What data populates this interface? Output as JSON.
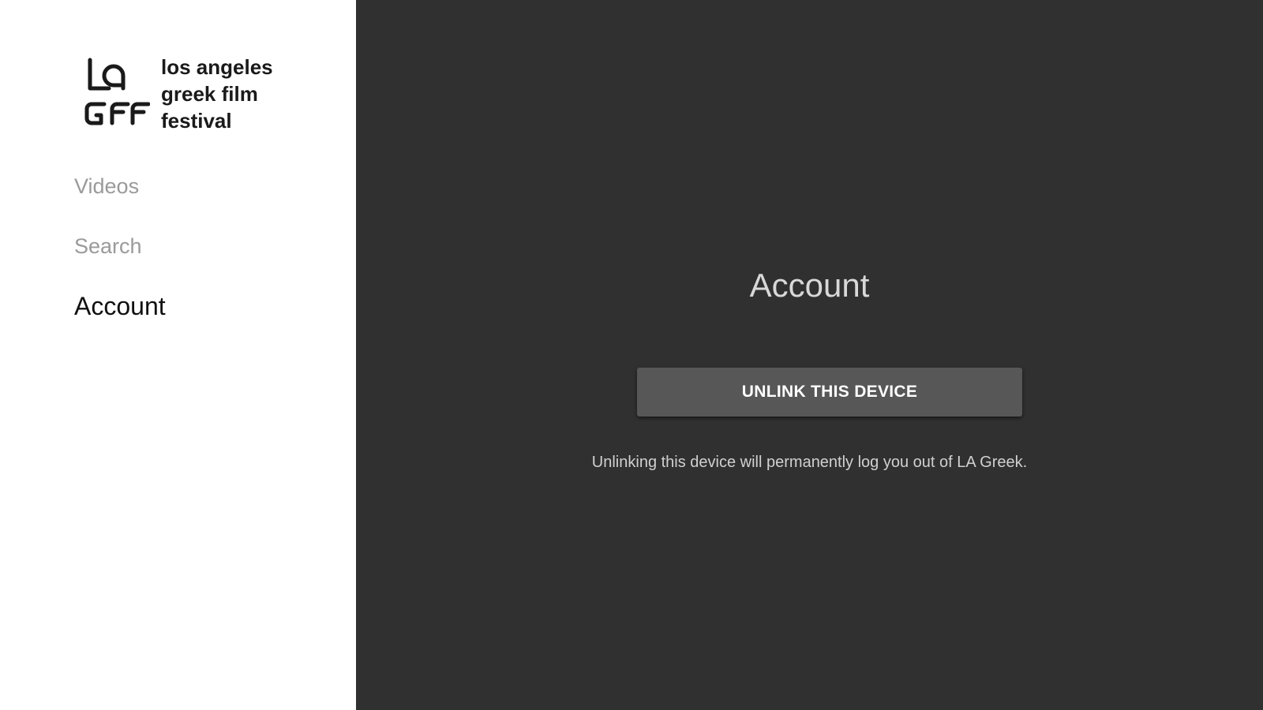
{
  "brand": {
    "logo_icon": "lagff-logo-icon",
    "line1": "los angeles",
    "line2": "greek film",
    "line3": "festival"
  },
  "nav": {
    "items": [
      {
        "label": "Videos"
      },
      {
        "label": "Search"
      },
      {
        "label": "Account"
      }
    ]
  },
  "main": {
    "title": "Account",
    "unlink_label": "UNLINK THIS DEVICE",
    "note": "Unlinking this device will permanently log you out of LA Greek."
  },
  "colors": {
    "sidebar_bg": "#ffffff",
    "main_bg": "#303030",
    "button_bg": "#575757"
  }
}
